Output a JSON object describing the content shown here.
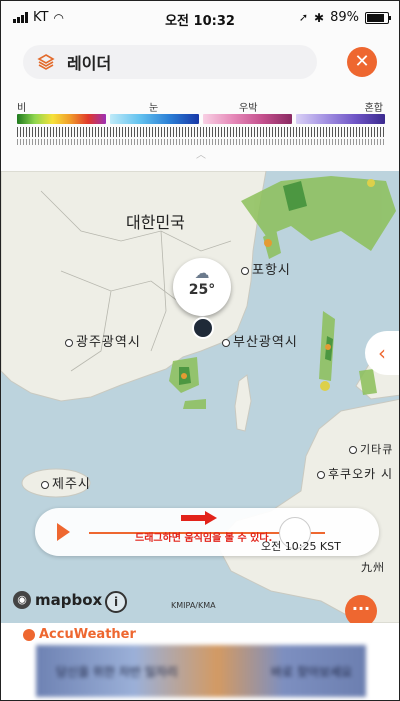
{
  "status_bar": {
    "carrier": "KT",
    "time": "오전 10:32",
    "battery": "89%"
  },
  "header": {
    "title": "레이더"
  },
  "legend": {
    "labels": [
      "비",
      "눈",
      "우박",
      "혼합"
    ],
    "bar_colors": [
      "linear-gradient(90deg,#1f7a1f,#8fd64f,#f6e13a,#f09a2a,#e0392b,#9c2fb5)",
      "linear-gradient(90deg,#bfeaf8,#63c2ef,#2b7fd6,#1838a8)",
      "linear-gradient(90deg,#f8d0e4,#e68ab9,#c4508d,#8a2a62)",
      "linear-gradient(90deg,#d9d0f6,#a391e2,#6f55c6,#3b2a8f)"
    ]
  },
  "map": {
    "places": {
      "korea": "대한민국",
      "pohang": "포항시",
      "busan": "부산광역시",
      "gwangju": "광주광역시",
      "jeju": "제주시",
      "kitakyushu": "기타큐",
      "fukuoka": "후쿠오카 시",
      "kyushu": "九州"
    },
    "marker": {
      "temp": "25°",
      "icon": "rain-cloud-icon"
    },
    "attribution": "KMIPA/KMA",
    "mapbox_label": "mapbox"
  },
  "player": {
    "time": "오전 10:25 KST",
    "overlay_text": "드래그하면 움직임을 볼 수 있다.",
    "progress": 0.87
  },
  "footer": {
    "brand": "AccuWeather",
    "ad_text_left": "당신을 위한 차반 일자리",
    "ad_text_right": "바로 찾아보세요"
  }
}
